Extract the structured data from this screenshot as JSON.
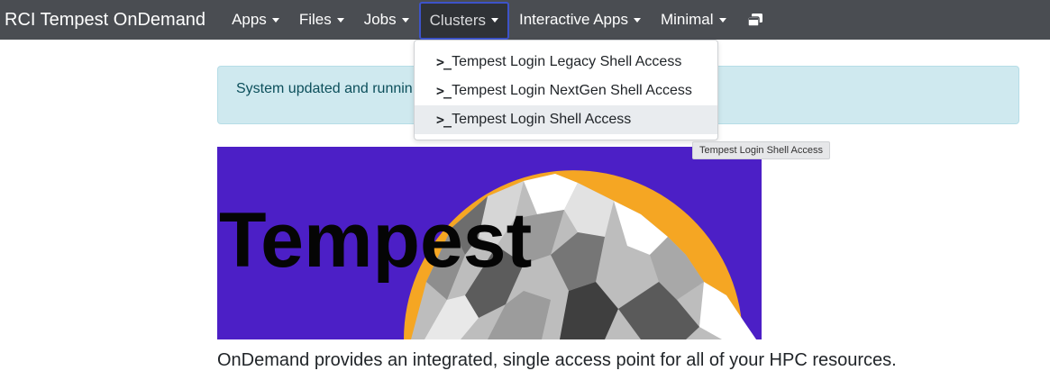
{
  "navbar": {
    "brand": "RCI Tempest OnDemand",
    "items": [
      {
        "label": "Apps"
      },
      {
        "label": "Files"
      },
      {
        "label": "Jobs"
      },
      {
        "label": "Clusters"
      },
      {
        "label": "Interactive Apps"
      },
      {
        "label": "Minimal"
      }
    ],
    "icon": "windows-icon"
  },
  "alert": {
    "text": "System updated and runnin"
  },
  "dropdown": {
    "prompt_icon": ">_",
    "items": [
      {
        "label": "Tempest Login Legacy Shell Access"
      },
      {
        "label": "Tempest Login NextGen Shell Access"
      },
      {
        "label": "Tempest Login Shell Access"
      }
    ]
  },
  "tooltip": {
    "text": "Tempest Login Shell Access"
  },
  "banner": {
    "logo_text": "Tempest",
    "colors": {
      "background": "#4c1fc6",
      "sun": "#f5a623",
      "text": "#050505"
    }
  },
  "main": {
    "lead": "OnDemand provides an integrated, single access point for all of your HPC resources."
  }
}
